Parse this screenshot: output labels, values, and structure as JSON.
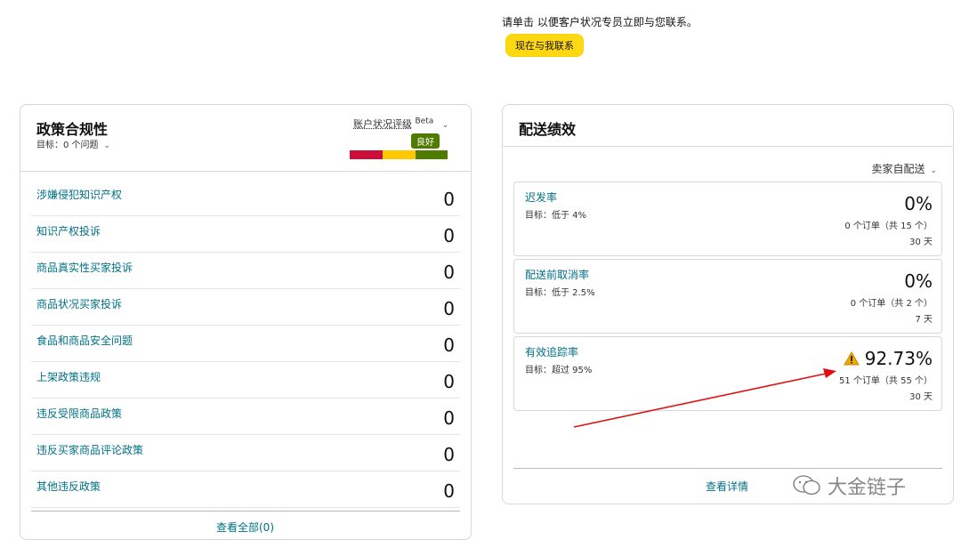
{
  "notice": "请单击 以便客户状况专员立即与您联系。",
  "contact_button": "现在与我联系",
  "policy": {
    "title": "政策合规性",
    "target": "目标：0 个问题",
    "rating_label": "账户状况评级",
    "beta": "Beta",
    "rating_badge": "良好",
    "items": [
      {
        "label": "涉嫌侵犯知识产权",
        "value": "0"
      },
      {
        "label": "知识产权投诉",
        "value": "0"
      },
      {
        "label": "商品真实性买家投诉",
        "value": "0"
      },
      {
        "label": "商品状况买家投诉",
        "value": "0"
      },
      {
        "label": "食品和商品安全问题",
        "value": "0"
      },
      {
        "label": "上架政策违规",
        "value": "0"
      },
      {
        "label": "违反受限商品政策",
        "value": "0"
      },
      {
        "label": "违反买家商品评论政策",
        "value": "0"
      },
      {
        "label": "其他违反政策",
        "value": "0"
      }
    ],
    "see_all": "查看全部(0)"
  },
  "shipping": {
    "title": "配送绩效",
    "filter": "卖家自配送",
    "metrics": [
      {
        "name": "迟发率",
        "target": "目标：低于 4%",
        "value": "0%",
        "orders": "0 个订单（共 15 个）",
        "days": "30 天"
      },
      {
        "name": "配送前取消率",
        "target": "目标：低于 2.5%",
        "value": "0%",
        "orders": "0 个订单（共 2 个）",
        "days": "7 天"
      },
      {
        "name": "有效追踪率",
        "target": "目标：超过 95%",
        "value": "92.73%",
        "orders": "51 个订单（共 55 个）",
        "days": "30 天"
      }
    ],
    "see_details": "查看详情"
  },
  "watermark": "大金链子",
  "colors": {
    "link": "#007185",
    "button": "#ffd814",
    "rating_red": "#cc0c39",
    "rating_yellow": "#ffc800",
    "rating_green": "#4f7b00",
    "arrow": "#e01010",
    "warning": "#f0a500"
  }
}
